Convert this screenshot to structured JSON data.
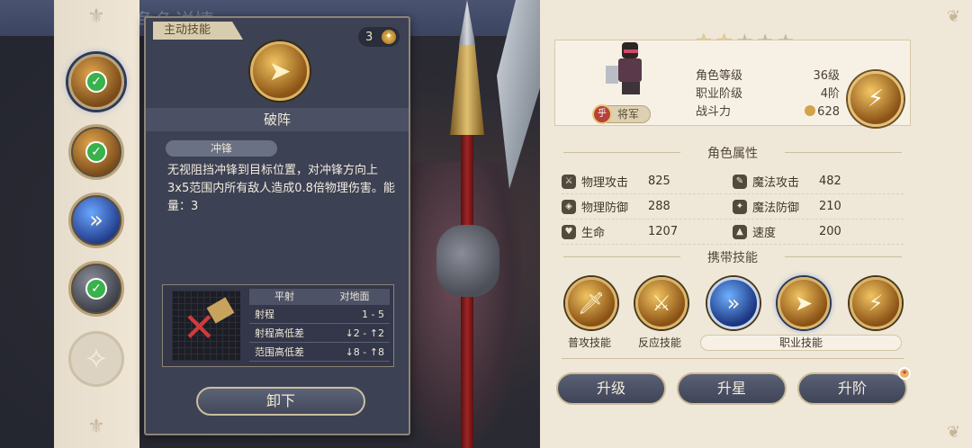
{
  "background": {
    "banner_title": "角色详情"
  },
  "rail": {
    "skills": [
      {
        "icon": "pierce-arrow-icon",
        "checked": true,
        "active": true
      },
      {
        "icon": "counter-slash-icon",
        "checked": true,
        "active": false
      },
      {
        "icon": "dash-runner-icon",
        "checked": false,
        "active": false
      },
      {
        "icon": "dash-runner-icon",
        "checked": true,
        "active": false
      },
      {
        "icon": "empty-slot-icon",
        "checked": false,
        "active": false
      }
    ]
  },
  "detail": {
    "tag": "主动技能",
    "energy_cost": "3",
    "energy_symbol": "✦",
    "name": "破阵",
    "type_label": "冲锋",
    "description": "无视阻挡冲锋到目标位置，对冲锋方向上3x5范围内所有敌人造成0.8倍物理伤害。能量：3",
    "range": {
      "headers": [
        "平射",
        "对地面"
      ],
      "rows": [
        {
          "key": "射程",
          "value": "1 - 5"
        },
        {
          "key": "射程高低差",
          "value": "↓2 - ↑2"
        },
        {
          "key": "范围高低差",
          "value": "↓8 - ↑8"
        }
      ]
    },
    "unequip_label": "卸下"
  },
  "character": {
    "stars_total": 5,
    "stars_lit": 2,
    "title": "将军",
    "medal_char": "乎",
    "info": [
      {
        "key": "角色等级",
        "value": "36级"
      },
      {
        "key": "职业阶级",
        "value": "4阶"
      },
      {
        "key": "战斗力",
        "value": "628"
      }
    ]
  },
  "attributes": {
    "section_title": "角色属性",
    "rows": [
      [
        {
          "icon": "sword-icon",
          "key": "物理攻击",
          "value": "825"
        },
        {
          "icon": "wand-icon",
          "key": "魔法攻击",
          "value": "482"
        }
      ],
      [
        {
          "icon": "shield-icon",
          "key": "物理防御",
          "value": "288"
        },
        {
          "icon": "magic-shield-icon",
          "key": "魔法防御",
          "value": "210"
        }
      ],
      [
        {
          "icon": "heart-icon",
          "key": "生命",
          "value": "1207"
        },
        {
          "icon": "boot-icon",
          "key": "速度",
          "value": "200"
        }
      ]
    ]
  },
  "equipped": {
    "section_title": "携带技能",
    "skills": [
      {
        "icon": "sword-strike-icon",
        "color": "gold"
      },
      {
        "icon": "sword-counter-icon",
        "color": "gold"
      },
      {
        "icon": "dash-runner-icon",
        "color": "blue"
      },
      {
        "icon": "pierce-arrow-icon",
        "color": "gold"
      },
      {
        "icon": "lightning-burst-icon",
        "color": "gold"
      }
    ],
    "labels": {
      "basic": "普攻技能",
      "reaction": "反应技能",
      "class": "职业技能"
    }
  },
  "actions": {
    "upgrade": "升级",
    "star_up": "升星",
    "advance": "升阶"
  },
  "colors": {
    "panel_bg": "#3d4154",
    "cream": "#efe7d7",
    "gold": "#d9b46a",
    "check": "#39b14c"
  }
}
